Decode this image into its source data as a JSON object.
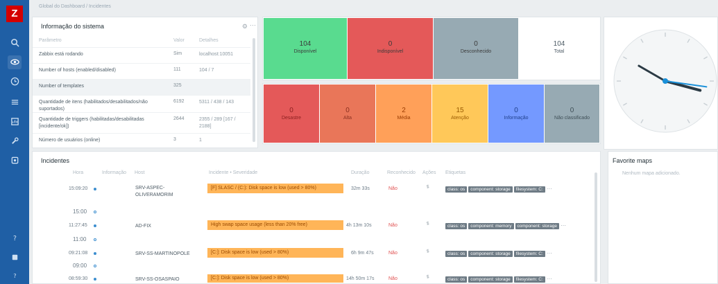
{
  "breadcrumb": "Global do Dashboard / Incidentes",
  "sidebar": {
    "logo": "Z",
    "icons": [
      "search-icon",
      "eye-icon",
      "clock-icon",
      "list-icon",
      "report-icon",
      "wrench-icon",
      "cog-icon",
      "help-icon",
      "user-icon",
      "question-icon"
    ]
  },
  "system_info": {
    "title": "Informação do sistema",
    "columns": [
      "Parâmetro",
      "Valor",
      "Detalhes"
    ],
    "rows": [
      {
        "param": "Zabbix está rodando",
        "value": "Sim",
        "details": "localhost:10051"
      },
      {
        "param": "Number of hosts (enabled/disabled)",
        "value": "111",
        "details": "104 / 7"
      },
      {
        "param": "Number of templates",
        "value": "325",
        "details": ""
      },
      {
        "param": "Quantidade de itens (habilitados/desabilitados/não suportados)",
        "value": "6192",
        "details": "5311 / 438 / 143"
      },
      {
        "param": "Quantidade de triggers (habilitadas/desabilitadas [incidente/ok])",
        "value": "2644",
        "details": "2355 / 289 [167 / 2188]"
      },
      {
        "param": "Número de usuários (online)",
        "value": "3",
        "details": "1"
      }
    ]
  },
  "availability": {
    "tiles": [
      {
        "label": "Disponível",
        "value": "104",
        "color": "#59db8f"
      },
      {
        "label": "Indisponível",
        "value": "0",
        "color": "#e45959"
      },
      {
        "label": "Desconhecido",
        "value": "0",
        "color": "#97aab3"
      },
      {
        "label": "Total",
        "value": "104",
        "color": "#ffffff"
      }
    ]
  },
  "severity": {
    "tiles": [
      {
        "label": "Desastre",
        "value": "0",
        "color": "#e45959"
      },
      {
        "label": "Alta",
        "value": "0",
        "color": "#e97659"
      },
      {
        "label": "Média",
        "value": "2",
        "color": "#ffa059"
      },
      {
        "label": "Atenção",
        "value": "15",
        "color": "#ffc859"
      },
      {
        "label": "Informação",
        "value": "0",
        "color": "#7499ff"
      },
      {
        "label": "Não classificado",
        "value": "0",
        "color": "#97aab3"
      }
    ]
  },
  "incidents": {
    "title": "Incidentes",
    "columns": [
      "Hora",
      "Informação",
      "Host",
      "Incidente • Severidade",
      "Duração",
      "Reconhecido",
      "Ações",
      "Etiquetas"
    ],
    "rows": [
      {
        "time": "15:09:20",
        "host": "SRV-ASPEC-OLIVERAMORIM",
        "problem": "[F] SLASC / (C:): Disk space is low (used > 80%)",
        "duration": "32m 33s",
        "ack": "Não",
        "tags": [
          "class: os",
          "component: storage",
          "filesystem: C:"
        ]
      },
      {
        "time": "11:27:45",
        "host": "AD-FIX",
        "problem": "High swap space usage (less than 20% free)",
        "duration": "4h 13m 10s",
        "ack": "Não",
        "tags": [
          "class: os",
          "component: memory",
          "component: storage"
        ]
      },
      {
        "time": "09:21:08",
        "host": "SRV-SS-MARTINOPOLE",
        "problem": "[C:]: Disk space is low (used > 80%)",
        "duration": "6h 9m 47s",
        "ack": "Não",
        "tags": [
          "class: os",
          "component: storage",
          "filesystem: C:"
        ]
      },
      {
        "time": "08:59:30",
        "host": "SRV-SS-OSASPAIO",
        "problem": "[C:]: Disk space is low (used > 80%)",
        "duration": "14h 50m 17s",
        "ack": "Não",
        "tags": [
          "class: os",
          "component: storage",
          "filesystem: C:"
        ]
      }
    ],
    "markers": [
      "15:00",
      "11:00",
      "09:00"
    ],
    "more": "⋯"
  },
  "favorite_maps": {
    "title": "Favorite maps",
    "empty": "Nenhum mapa adicionado."
  },
  "clock": {
    "hour_deg": 105,
    "minute_deg": 300,
    "second_deg": 98
  }
}
